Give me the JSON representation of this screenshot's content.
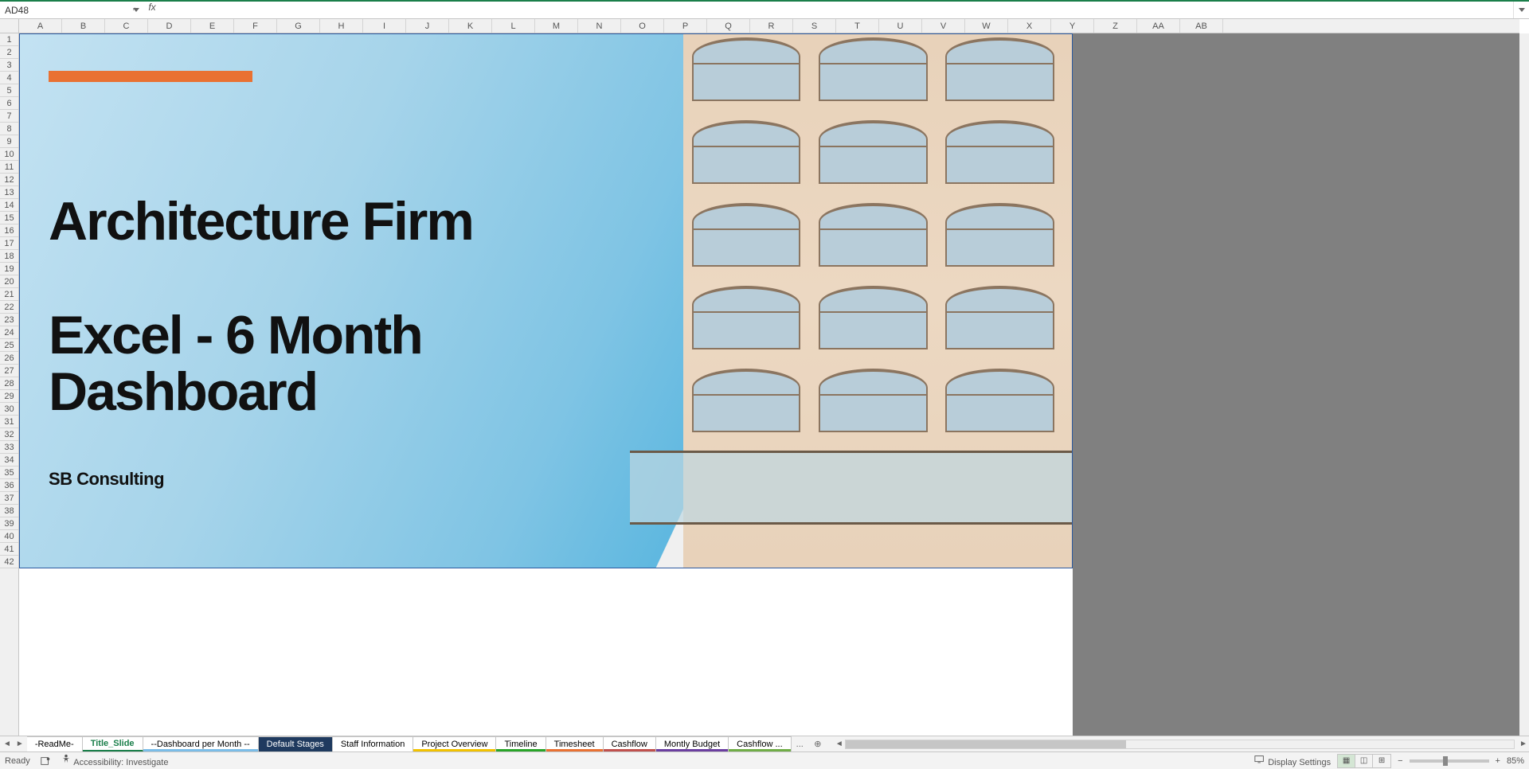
{
  "namebox": {
    "value": "AD48"
  },
  "fx": {
    "cancel": "✕",
    "enter": "✓",
    "label": "fx"
  },
  "formula": {
    "value": ""
  },
  "columns": [
    "A",
    "B",
    "C",
    "D",
    "E",
    "F",
    "G",
    "H",
    "I",
    "J",
    "K",
    "L",
    "M",
    "N",
    "O",
    "P",
    "Q",
    "R",
    "S",
    "T",
    "U",
    "V",
    "W",
    "X",
    "Y",
    "Z",
    "AA",
    "AB"
  ],
  "rows_visible": 42,
  "slide": {
    "title_line1": "Architecture Firm",
    "title_line2": "Excel - 6 Month",
    "title_line3": "Dashboard",
    "subtitle": "SB Consulting"
  },
  "tabs": [
    {
      "label": "-ReadMe-",
      "color": null,
      "active": false
    },
    {
      "label": "Title_Slide",
      "color": "#1a7f4a",
      "active": true
    },
    {
      "label": "--Dashboard per Month --",
      "color": "#7bbde8",
      "active": false
    },
    {
      "label": "Default Stages",
      "color": "#1f3a5f",
      "active": false,
      "textcolor": "#fff"
    },
    {
      "label": "Staff Information",
      "color": null,
      "active": false
    },
    {
      "label": "Project Overview",
      "color": "#f2c200",
      "active": false
    },
    {
      "label": "Timeline",
      "color": "#28a428",
      "active": false
    },
    {
      "label": "Timesheet",
      "color": "#e97132",
      "active": false
    },
    {
      "label": "Cashflow",
      "color": "#c0504d",
      "active": false
    },
    {
      "label": "Montly Budget",
      "color": "#6b3fa0",
      "active": false
    },
    {
      "label": "Cashflow ...",
      "color": "#70ad47",
      "active": false
    }
  ],
  "tab_more": "...",
  "tab_add_circle_tooltip": "New sheet",
  "status": {
    "ready": "Ready",
    "accessibility": "Accessibility: Investigate",
    "display_settings": "Display Settings",
    "zoom": "85%"
  },
  "zoom_controls": {
    "minus": "−",
    "plus": "+"
  }
}
